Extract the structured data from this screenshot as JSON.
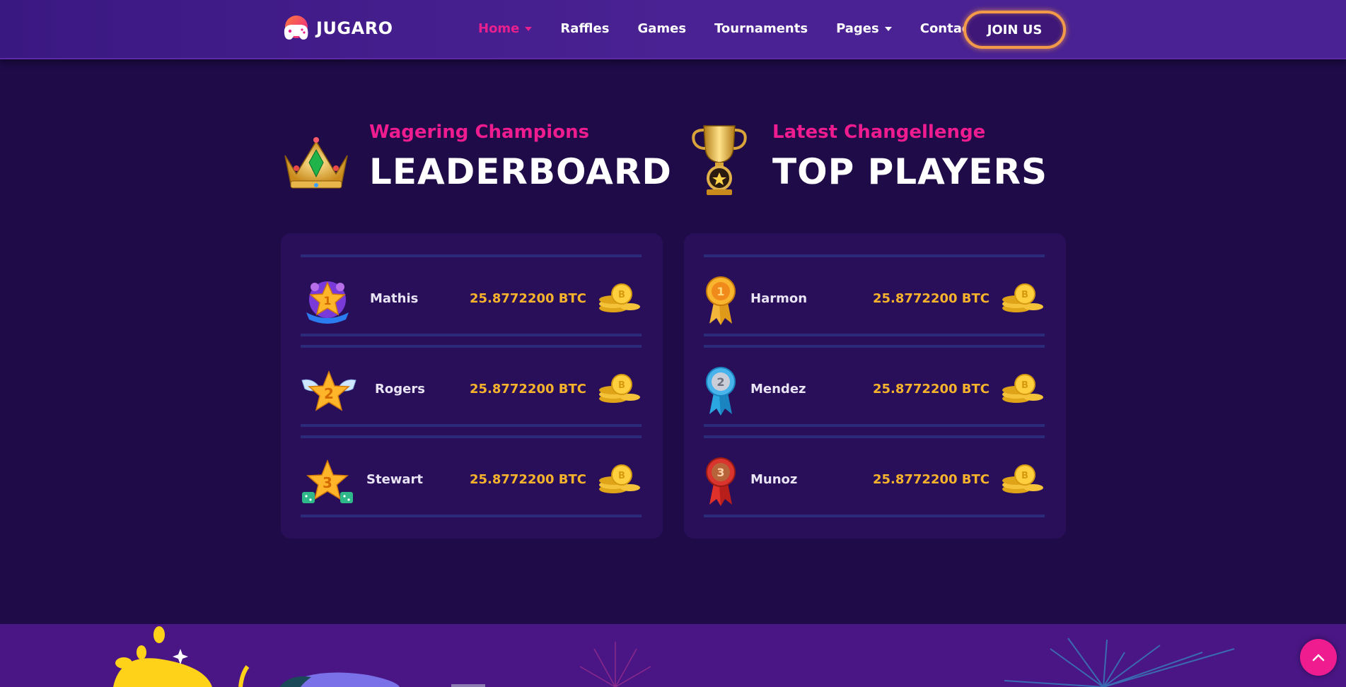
{
  "brand": {
    "name": "JUGARO",
    "logo_icon": "gamepad-logo-icon"
  },
  "nav": {
    "items": [
      {
        "label": "Home",
        "active": true,
        "dropdown": true
      },
      {
        "label": "Raffles",
        "active": false,
        "dropdown": false
      },
      {
        "label": "Games",
        "active": false,
        "dropdown": false
      },
      {
        "label": "Tournaments",
        "active": false,
        "dropdown": false
      },
      {
        "label": "Pages",
        "active": false,
        "dropdown": true
      },
      {
        "label": "Contact",
        "active": false,
        "dropdown": false
      }
    ],
    "join_label": "JOIN US"
  },
  "leaderboard": {
    "subtitle": "Wagering Champions",
    "title": "LEADERBOARD",
    "icon": "crown-icon",
    "rows": [
      {
        "name": "Mathis",
        "amount": "25.8772200 BTC",
        "badge": "level-1-badge-icon"
      },
      {
        "name": "Rogers",
        "amount": "25.8772200 BTC",
        "badge": "winged-star-2-icon"
      },
      {
        "name": "Stewart",
        "amount": "25.8772200 BTC",
        "badge": "star-3-dice-icon"
      }
    ]
  },
  "top_players": {
    "subtitle": "Latest Changellenge",
    "title": "TOP PLAYERS",
    "icon": "trophy-icon",
    "rows": [
      {
        "name": "Harmon",
        "amount": "25.8772200 BTC",
        "badge": "gold-medal-1-icon"
      },
      {
        "name": "Mendez",
        "amount": "25.8772200 BTC",
        "badge": "silver-medal-2-icon"
      },
      {
        "name": "Munoz",
        "amount": "25.8772200 BTC",
        "badge": "bronze-medal-3-icon"
      }
    ]
  },
  "colors": {
    "background": "#1e0b48",
    "header": "#4a2293",
    "card": "#290f5a",
    "accent_pink": "#ee1c8f",
    "amount_gold": "#f7b32b",
    "join_border": "#f39a4a"
  }
}
